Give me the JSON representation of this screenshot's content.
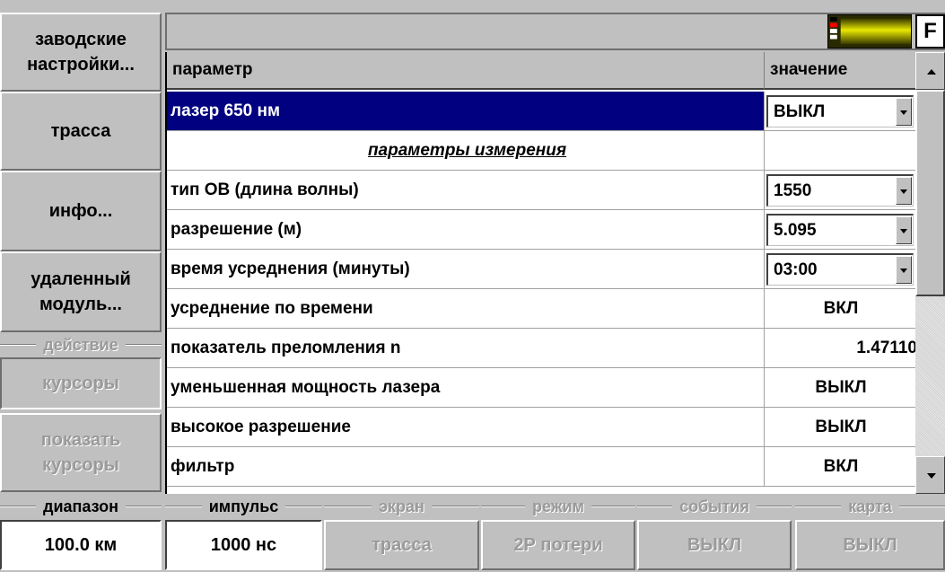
{
  "sidebar": {
    "factory_settings": "заводские\nнастройки...",
    "trace": "трасса",
    "info": "инфо...",
    "remote_module": "удаленный\nмодуль...",
    "action_group": "действие",
    "cursors": "курсоры",
    "show_cursors": "показать\nкурсоры"
  },
  "topbar": {
    "f_button": "F"
  },
  "table": {
    "col_param": "параметр",
    "col_value": "значение",
    "rows": [
      {
        "param": "лазер 650 нм",
        "value": "ВЫКЛ"
      },
      {
        "param": "параметры измерения",
        "value": ""
      },
      {
        "param": "тип ОВ (длина волны)",
        "value": "1550"
      },
      {
        "param": "разрешение (м)",
        "value": "5.095"
      },
      {
        "param": "время усреднения (минуты)",
        "value": "03:00"
      },
      {
        "param": "усреднение по времени",
        "value": "ВКЛ"
      },
      {
        "param": "показатель преломления n",
        "value": "1.47110"
      },
      {
        "param": "уменьшенная мощность лазера",
        "value": "ВЫКЛ"
      },
      {
        "param": "высокое разрешение",
        "value": "ВЫКЛ"
      },
      {
        "param": "фильтр",
        "value": "ВКЛ"
      }
    ]
  },
  "bottombar": {
    "range_label": "диапазон",
    "range_value": "100.0 км",
    "pulse_label": "импульс",
    "pulse_value": "1000 нс",
    "screen_label": "экран",
    "screen_value": "трасса",
    "mode_label": "режим",
    "mode_value": "2Р потери",
    "events_label": "события",
    "events_value": "ВЫКЛ",
    "map_label": "карта",
    "map_value": "ВЫКЛ"
  },
  "colors": {
    "selection": "#000080",
    "panel": "#c0c0c0",
    "disabled_text": "#9a9a9a"
  }
}
